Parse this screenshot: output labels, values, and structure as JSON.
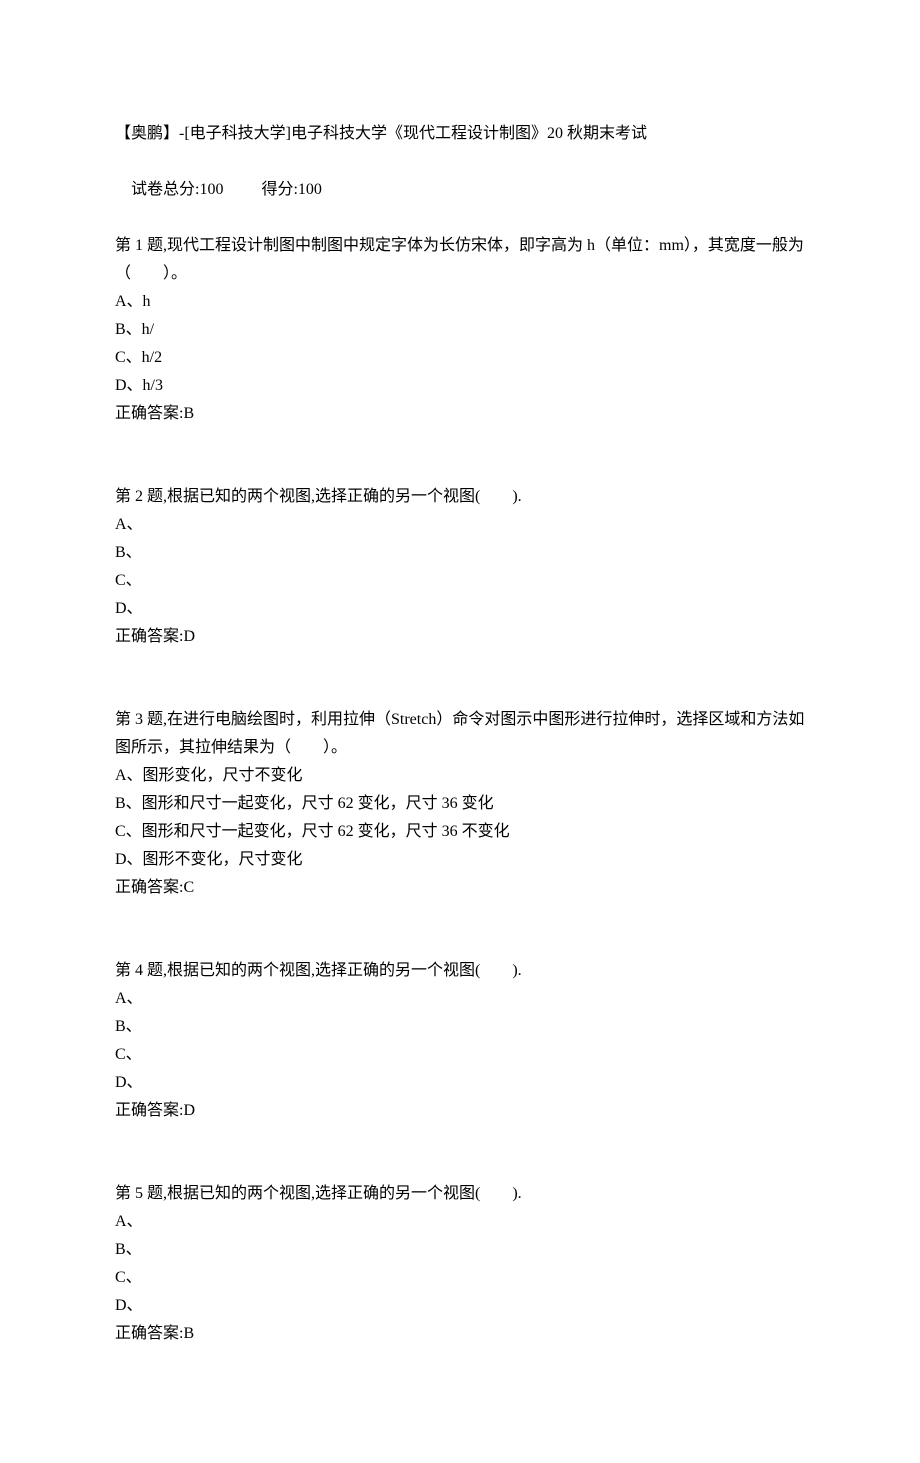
{
  "header": {
    "title": "【奥鹏】-[电子科技大学]电子科技大学《现代工程设计制图》20 秋期末考试",
    "score_total_label": "试卷总分:100",
    "score_got_label": "得分:100"
  },
  "questions": [
    {
      "stem": "第 1 题,现代工程设计制图中制图中规定字体为长仿宋体，即字高为 h（单位：mm），其宽度一般为（　　）。",
      "options": {
        "A": "A、h",
        "B": "B、h/",
        "C": "C、h/2",
        "D": "D、h/3"
      },
      "answer": "正确答案:B"
    },
    {
      "stem": "第 2 题,根据已知的两个视图,选择正确的另一个视图(　　).",
      "options": {
        "A": "A、",
        "B": "B、",
        "C": "C、",
        "D": "D、"
      },
      "answer": "正确答案:D"
    },
    {
      "stem": "第 3 题,在进行电脑绘图时，利用拉伸（Stretch）命令对图示中图形进行拉伸时，选择区域和方法如图所示，其拉伸结果为（　　）。",
      "options": {
        "A": "A、图形变化，尺寸不变化",
        "B": "B、图形和尺寸一起变化，尺寸 62 变化，尺寸 36 变化",
        "C": "C、图形和尺寸一起变化，尺寸 62 变化，尺寸 36 不变化",
        "D": "D、图形不变化，尺寸变化"
      },
      "answer": "正确答案:C"
    },
    {
      "stem": "第 4 题,根据已知的两个视图,选择正确的另一个视图(　　).",
      "options": {
        "A": "A、",
        "B": "B、",
        "C": "C、",
        "D": "D、"
      },
      "answer": "正确答案:D"
    },
    {
      "stem": "第 5 题,根据已知的两个视图,选择正确的另一个视图(　　).",
      "options": {
        "A": "A、",
        "B": "B、",
        "C": "C、",
        "D": "D、"
      },
      "answer": "正确答案:B"
    }
  ]
}
